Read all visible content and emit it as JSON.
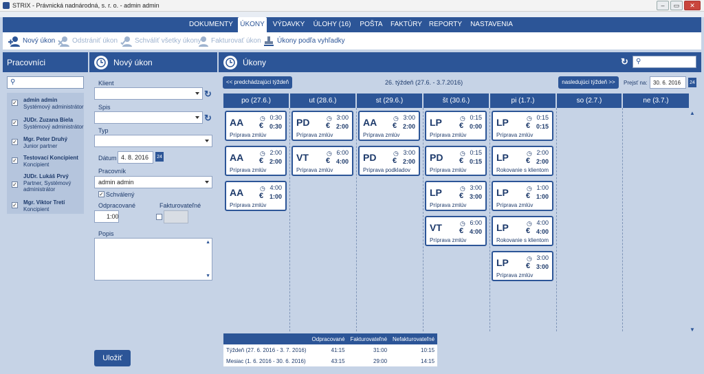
{
  "window": {
    "title": "STRIX - Právnická nadnárodná, s. r. o. - admin admin"
  },
  "nav": {
    "tabs": [
      {
        "label": "DOKUMENTY",
        "active": false
      },
      {
        "label": "ÚKONY",
        "active": true
      },
      {
        "label": "VÝDAVKY",
        "active": false
      },
      {
        "label": "ÚLOHY (16)",
        "active": false
      },
      {
        "label": "POŠTA",
        "active": false
      },
      {
        "label": "FAKTÚRY",
        "active": false
      },
      {
        "label": "REPORTY",
        "active": false
      },
      {
        "label": "NASTAVENIA",
        "active": false
      }
    ]
  },
  "toolbar": {
    "new": "Nový úkon",
    "delete": "Odstrániť úkon",
    "approve_all": "Schváliť všetky úkony",
    "invoice": "Fakturovať úkon",
    "by_search": "Úkony podľa vyhľadky"
  },
  "workers_panel": {
    "title": "Pracovníci",
    "items": [
      {
        "name": "admin admin",
        "role": "Systémový administrátor",
        "checked": true
      },
      {
        "name": "JUDr. Zuzana Biela",
        "role": "Systémový administrátor",
        "checked": true
      },
      {
        "name": "Mgr. Peter Druhý",
        "role": "Junior partner",
        "checked": true
      },
      {
        "name": "Testovací Koncipient",
        "role": "Koncipient",
        "checked": true
      },
      {
        "name": "JUDr. Lukáš Prvý",
        "role": "Partner, Systémový administrátor",
        "checked": true
      },
      {
        "name": "Mgr. Viktor Tretí",
        "role": "Koncipient",
        "checked": true
      }
    ]
  },
  "form": {
    "title": "Nový úkon",
    "klient_label": "Klient",
    "spis_label": "Spis",
    "typ_label": "Typ",
    "datum_label": "Dátum",
    "datum_value": "4. 8. 2016",
    "pracovnik_label": "Pracovník",
    "pracovnik_value": "admin admin",
    "schvaleny_label": "Schválený",
    "odpracovane_label": "Odpracované",
    "odpracovane_value": "1:00",
    "fakturovatelne_label": "Fakturovateľné",
    "popis_label": "Popis",
    "save": "Uložiť"
  },
  "actions_panel": {
    "title": "Úkony",
    "prev_week": "<< predchádzajúci týždeň",
    "week_label": "26. týždeň (27.6. - 3.7.2016)",
    "next_week": "nasledujúci týždeň >>",
    "goto_label": "Prejsť na:",
    "goto_value": "30. 6. 2016",
    "days": [
      "po (27.6.)",
      "ut (28.6.)",
      "st (29.6.)",
      "št (30.6.)",
      "pi (1.7.)",
      "so (2.7.)",
      "ne (3.7.)"
    ],
    "columns": [
      [
        {
          "code": "AA",
          "time": "0:30",
          "bill": "0:30",
          "desc": "Príprava zmlúv"
        },
        {
          "code": "AA",
          "time": "2:00",
          "bill": "2:00",
          "desc": "Príprava zmlúv"
        },
        {
          "code": "AA",
          "time": "4:00",
          "bill": "1:00",
          "desc": "Príprava zmlúv"
        }
      ],
      [
        {
          "code": "PD",
          "time": "3:00",
          "bill": "2:00",
          "desc": "Príprava zmlúv"
        },
        {
          "code": "VT",
          "time": "6:00",
          "bill": "4:00",
          "desc": "Príprava zmlúv"
        }
      ],
      [
        {
          "code": "AA",
          "time": "3:00",
          "bill": "2:00",
          "desc": "Príprava zmlúv"
        },
        {
          "code": "PD",
          "time": "3:00",
          "bill": "2:00",
          "desc": "Príprava podkladov"
        }
      ],
      [
        {
          "code": "LP",
          "time": "0:15",
          "bill": "0:00",
          "desc": "Príprava zmlúv"
        },
        {
          "code": "PD",
          "time": "0:15",
          "bill": "0:15",
          "desc": "Príprava zmlúv"
        },
        {
          "code": "LP",
          "time": "3:00",
          "bill": "3:00",
          "desc": "Príprava zmlúv"
        },
        {
          "code": "VT",
          "time": "6:00",
          "bill": "4:00",
          "desc": "Príprava zmlúv"
        }
      ],
      [
        {
          "code": "LP",
          "time": "0:15",
          "bill": "0:15",
          "desc": "Príprava zmlúv"
        },
        {
          "code": "LP",
          "time": "2:00",
          "bill": "2:00",
          "desc": "Rokovanie s klientom"
        },
        {
          "code": "LP",
          "time": "1:00",
          "bill": "1:00",
          "desc": "Príprava zmlúv"
        },
        {
          "code": "LP",
          "time": "4:00",
          "bill": "4:00",
          "desc": "Rokovanie s klientom"
        },
        {
          "code": "LP",
          "time": "3:00",
          "bill": "3:00",
          "desc": "Príprava zmlúv"
        }
      ],
      [],
      []
    ],
    "summary": {
      "headers": [
        "",
        "Odpracované",
        "Fakturovateľné",
        "Nefakturovateľné"
      ],
      "rows": [
        [
          "Týždeň (27. 6. 2016 - 3. 7. 2016)",
          "41:15",
          "31:00",
          "10:15"
        ],
        [
          "Mesiac (1. 6. 2016 - 30. 6. 2016)",
          "43:15",
          "29:00",
          "14:15"
        ]
      ]
    }
  },
  "colors": {
    "primary": "#2c5597",
    "background": "#c6d3e6"
  }
}
